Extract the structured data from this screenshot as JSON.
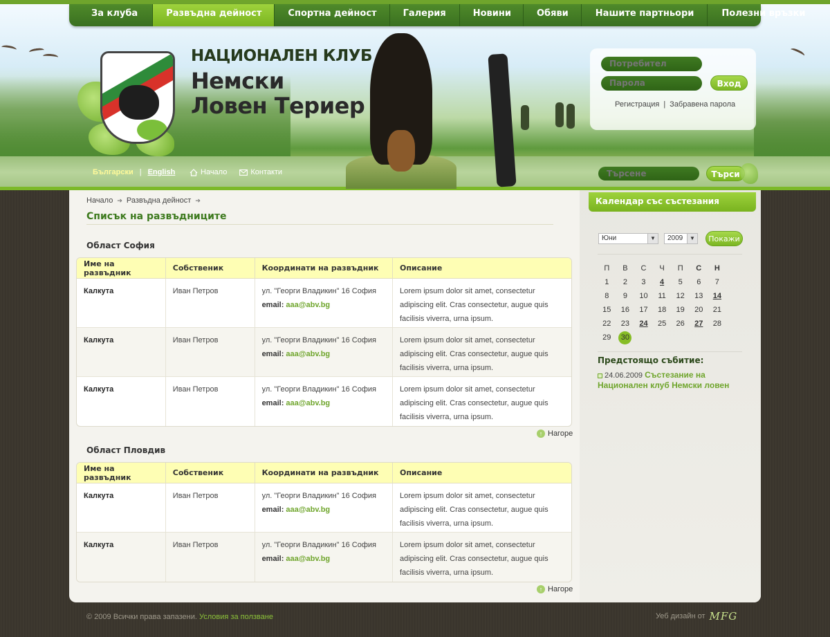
{
  "nav": {
    "items": [
      {
        "label": "За клуба"
      },
      {
        "label": "Развъдна дейност"
      },
      {
        "label": "Спортна дейност"
      },
      {
        "label": "Галерия"
      },
      {
        "label": "Новини"
      },
      {
        "label": "Обяви"
      },
      {
        "label": "Нашите партньори"
      },
      {
        "label": "Полезни връзки"
      }
    ],
    "active": "Развъдна дейност"
  },
  "site": {
    "title_line1": "НАЦИОНАЛЕН КЛУБ",
    "title_line2": "Немски",
    "title_line3": "Ловен Териер"
  },
  "login": {
    "user_placeholder": "Потребител",
    "password_placeholder": "Парола",
    "submit_label": "Вход",
    "register_label": "Регистрация",
    "forgot_label": "Забравена парола",
    "separator": "|"
  },
  "lang": {
    "bg": "Български",
    "en": "English",
    "separator": "|"
  },
  "subnav": {
    "home_label": "Начало",
    "contacts_label": "Контакти"
  },
  "search": {
    "placeholder": "Търсене",
    "button_label": "Търси"
  },
  "breadcrumb": {
    "items": [
      "Начало",
      "Развъдна дейност"
    ]
  },
  "page_title": "Списък на развъдниците",
  "table_headers": [
    "Име на развъдник",
    "Собственик",
    "Координати на развъдник",
    "Описание"
  ],
  "regions": [
    {
      "title": "Област София",
      "rows": [
        {
          "name": "Калкута",
          "owner": "Иван Петров",
          "address": "ул. \"Георги Владикин\" 16 София",
          "email_label": "email:",
          "email": "aaa@abv.bg",
          "description": "Lorem ipsum dolor sit amet, consectetur adipiscing elit. Cras consectetur, augue quis facilisis viverra, urna ipsum."
        },
        {
          "name": "Калкута",
          "owner": "Иван Петров",
          "address": "ул. \"Георги Владикин\" 16 София",
          "email_label": "email:",
          "email": "aaa@abv.bg",
          "description": "Lorem ipsum dolor sit amet, consectetur adipiscing elit. Cras consectetur, augue quis facilisis viverra, urna ipsum."
        },
        {
          "name": "Калкута",
          "owner": "Иван Петров",
          "address": "ул. \"Георги Владикин\" 16 София",
          "email_label": "email:",
          "email": "aaa@abv.bg",
          "description": "Lorem ipsum dolor sit amet, consectetur adipiscing elit. Cras consectetur, augue quis facilisis viverra, urna ipsum."
        }
      ]
    },
    {
      "title": "Област Пловдив",
      "rows": [
        {
          "name": "Калкута",
          "owner": "Иван Петров",
          "address": "ул. \"Георги Владикин\" 16 София",
          "email_label": "email:",
          "email": "aaa@abv.bg",
          "description": "Lorem ipsum dolor sit amet, consectetur adipiscing elit. Cras consectetur, augue quis facilisis viverra, urna ipsum."
        },
        {
          "name": "Калкута",
          "owner": "Иван Петров",
          "address": "ул. \"Георги Владикин\" 16 София",
          "email_label": "email:",
          "email": "aaa@abv.bg",
          "description": "Lorem ipsum dolor sit amet, consectetur adipiscing elit. Cras consectetur, augue quis facilisis viverra, urna ipsum."
        }
      ]
    }
  ],
  "top_link_label": "Нагоре",
  "calendar": {
    "title": "Календар със състезания",
    "month": "Юни",
    "year": "2009",
    "show_label": "Покажи",
    "weekdays": [
      "П",
      "В",
      "С",
      "Ч",
      "П",
      "С",
      "Н"
    ],
    "weeks": [
      [
        "1",
        "2",
        "3",
        "4",
        "5",
        "6",
        "7"
      ],
      [
        "8",
        "9",
        "10",
        "11",
        "12",
        "13",
        "14"
      ],
      [
        "15",
        "16",
        "17",
        "18",
        "19",
        "20",
        "21"
      ],
      [
        "22",
        "23",
        "24",
        "25",
        "26",
        "27",
        "28"
      ],
      [
        "29",
        "30",
        "",
        "",
        "",
        "",
        ""
      ]
    ],
    "event_days": [
      "4",
      "14",
      "24",
      "27"
    ],
    "today": "30"
  },
  "upcoming": {
    "title": "Предстоящо събитие:",
    "date": "24.06.2009",
    "event_title": "Състезание на Национален клуб Немски ловен"
  },
  "footer": {
    "copyright": "© 2009 Всички права запазени.",
    "terms_label": "Условия за ползване",
    "design_label": "Уеб дизайн  от",
    "brand": "MFG"
  },
  "colors": {
    "accent_green": "#7cb928",
    "nav_green": "#3a7020",
    "link_green": "#6fa52c",
    "header_yellow": "#fefeb4",
    "background_brown": "#3d382f"
  }
}
